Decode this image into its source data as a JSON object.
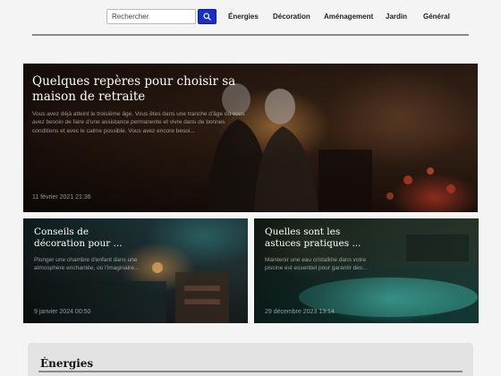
{
  "header": {
    "search_placeholder": "Rechercher",
    "nav": [
      {
        "label": "Énergies"
      },
      {
        "label": "Décoration"
      },
      {
        "label": "Aménagement"
      },
      {
        "label": "Jardin"
      },
      {
        "label": "Général"
      }
    ]
  },
  "featured": {
    "title": "Quelques repères pour choisir sa maison de retraite",
    "excerpt": "Vous avez déjà atteint le troisième âge. Vous êtes dans une tranche d'âge où vous avez besoin de faire d'une assistance permanente et vivre dans de bonnes conditions et avec le calme possible. Vous avez encore besoi...",
    "date": "11 février 2021 21:36"
  },
  "cards": [
    {
      "title": "Conseils de décoration pour ...",
      "excerpt": "Plonger une chambre d'enfant dans une atmosphère enchantée, où l'imaginaire...",
      "date": "9 janvier 2024 00:50"
    },
    {
      "title": "Quelles sont les astuces pratiques ...",
      "excerpt": "Maintenir une eau cristalline dans votre piscine est essentiel pour garantir des...",
      "date": "29 décembre 2023 13:14"
    }
  ],
  "section": {
    "title": "Énergies"
  },
  "colors": {
    "search_button": "#1830c6",
    "page_background": "#f4f4f4",
    "section_background": "#e3e3e3"
  }
}
